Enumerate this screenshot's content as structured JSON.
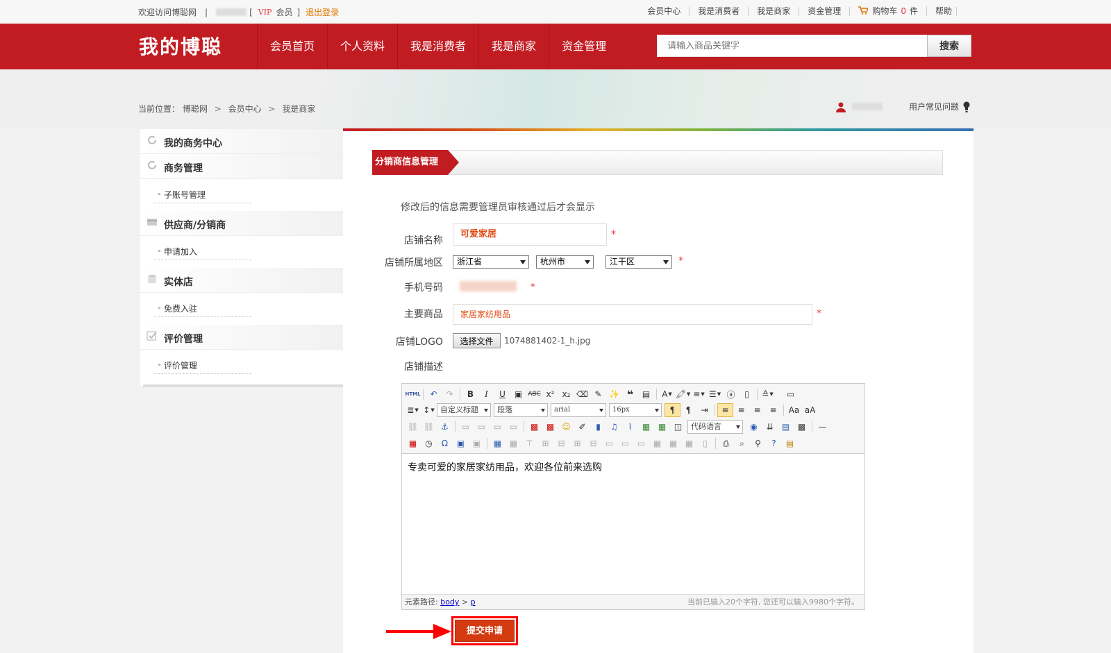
{
  "topbar": {
    "welcome": "欢迎访问博聪网",
    "divider": "|",
    "bracket_open": "[",
    "bracket_close": "]",
    "vip": "VIP",
    "member": "会员",
    "logout": "退出登录",
    "links": [
      "会员中心",
      "我是消费者",
      "我是商家",
      "资金管理"
    ],
    "cart_label": "购物车",
    "cart_count": "0",
    "cart_unit": "件",
    "help": "帮助"
  },
  "nav": {
    "logo": "我的博聪",
    "items": [
      "会员首页",
      "个人资料",
      "我是消费者",
      "我是商家",
      "资金管理"
    ],
    "search_placeholder": "请输入商品关键字",
    "search_button": "搜索"
  },
  "breadcrumb": {
    "prefix": "当前位置：",
    "items": [
      "博聪网",
      "会员中心",
      "我是商家"
    ],
    "separator": ">"
  },
  "user": {
    "faq": "用户常见问题"
  },
  "sidebar": {
    "sections": [
      {
        "title": "我的商务中心",
        "icon": "refresh-icon",
        "items": []
      },
      {
        "title": "商务管理",
        "icon": "refresh-icon",
        "items": [
          "子账号管理"
        ]
      },
      {
        "title": "供应商/分销商",
        "icon": "card-icon",
        "items": [
          "申请加入"
        ]
      },
      {
        "title": "实体店",
        "icon": "store-icon",
        "items": [
          "免费入驻"
        ]
      },
      {
        "title": "评价管理",
        "icon": "checkbox-icon",
        "items": [
          "评价管理"
        ]
      }
    ]
  },
  "panel": {
    "tab": "分销商信息管理",
    "notice": "修改后的信息需要管理员审核通过后才会显示",
    "required_mark": "*",
    "fields": {
      "shop_name_label": "店铺名称",
      "shop_name_value": "可爱家居",
      "region_label": "店铺所属地区",
      "province": "浙江省",
      "city": "杭州市",
      "district": "江干区",
      "phone_label": "手机号码",
      "goods_label": "主要商品",
      "goods_value": "家居家纺用品",
      "logo_label": "店铺LOGO",
      "file_button": "选择文件",
      "file_name": "1074881402-1_h.jpg",
      "desc_label": "店铺描述"
    }
  },
  "editor": {
    "html_btn": "HTML",
    "heading_select": "自定义标题",
    "paragraph_select": "段落",
    "font_select": "arial",
    "size_select": "16px",
    "code_select": "代码语言",
    "content": "专卖可爱的家居家纺用品，欢迎各位前来选购",
    "path_label": "元素路径:",
    "path_body": "body",
    "path_sep": ">",
    "path_p": "p",
    "char_count": "当前已输入20个字符, 您还可以输入9980个字符。"
  },
  "submit": {
    "label": "提交申请"
  },
  "colors": {
    "brand_red": "#c21c23",
    "accent_orange": "#e67700",
    "submit": "#d43a10",
    "annotation": "#ff0000"
  }
}
